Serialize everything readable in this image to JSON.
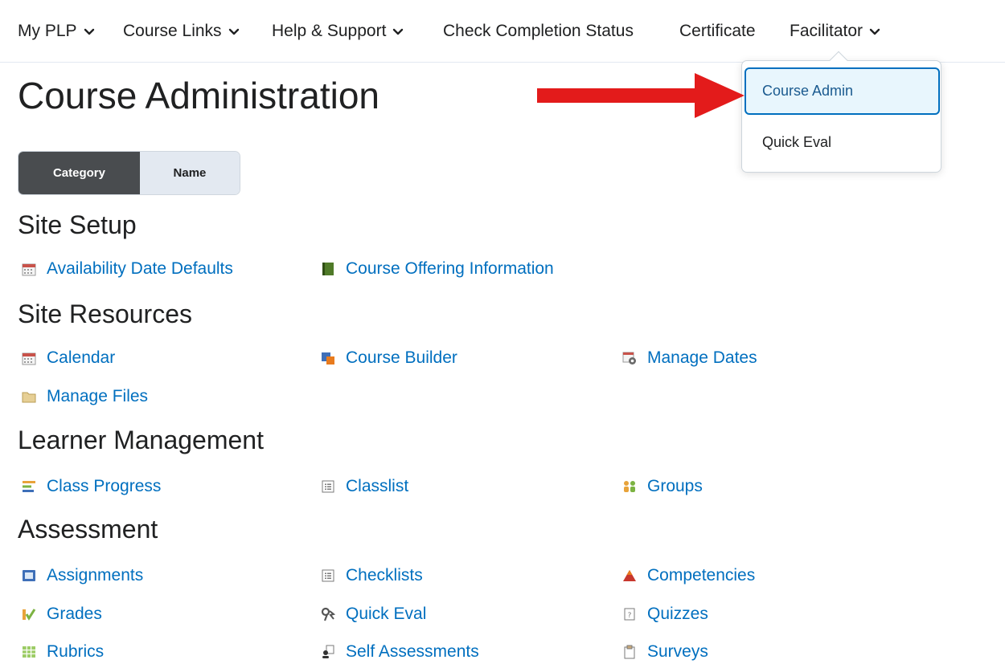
{
  "nav": {
    "items": [
      {
        "label": "My PLP",
        "dropdown": true
      },
      {
        "label": "Course Links",
        "dropdown": true
      },
      {
        "label": "Help & Support",
        "dropdown": true
      },
      {
        "label": "Check Completion Status",
        "dropdown": false
      },
      {
        "label": "Certificate",
        "dropdown": false
      },
      {
        "label": "Facilitator",
        "dropdown": true
      }
    ]
  },
  "facilitator_menu": {
    "items": [
      {
        "label": "Course Admin",
        "active": true
      },
      {
        "label": "Quick Eval",
        "active": false
      }
    ]
  },
  "page": {
    "title": "Course Administration"
  },
  "view_toggle": {
    "selected": "Category",
    "options": [
      "Category",
      "Name"
    ]
  },
  "sections": [
    {
      "heading": "Site Setup",
      "links": [
        {
          "label": "Availability Date Defaults",
          "icon": "calendar-icon"
        },
        {
          "label": "Course Offering Information",
          "icon": "book-icon"
        }
      ]
    },
    {
      "heading": "Site Resources",
      "links": [
        {
          "label": "Calendar",
          "icon": "calendar-icon"
        },
        {
          "label": "Course Builder",
          "icon": "course-builder-icon"
        },
        {
          "label": "Manage Dates",
          "icon": "manage-dates-icon"
        },
        {
          "label": "Manage Files",
          "icon": "folder-icon"
        }
      ]
    },
    {
      "heading": "Learner Management",
      "links": [
        {
          "label": "Class Progress",
          "icon": "class-progress-icon"
        },
        {
          "label": "Classlist",
          "icon": "list-icon"
        },
        {
          "label": "Groups",
          "icon": "groups-icon"
        }
      ]
    },
    {
      "heading": "Assessment",
      "links": [
        {
          "label": "Assignments",
          "icon": "assignment-icon"
        },
        {
          "label": "Checklists",
          "icon": "list-icon"
        },
        {
          "label": "Competencies",
          "icon": "competencies-icon"
        },
        {
          "label": "Grades",
          "icon": "grades-icon"
        },
        {
          "label": "Quick Eval",
          "icon": "quick-eval-icon"
        },
        {
          "label": "Quizzes",
          "icon": "quiz-icon"
        },
        {
          "label": "Rubrics",
          "icon": "rubrics-icon"
        },
        {
          "label": "Self Assessments",
          "icon": "self-assessment-icon"
        },
        {
          "label": "Surveys",
          "icon": "survey-icon"
        }
      ]
    }
  ],
  "colors": {
    "link": "#006fbf",
    "accent_arrow": "#e31b1b",
    "toggle_active": "#494c4f"
  }
}
